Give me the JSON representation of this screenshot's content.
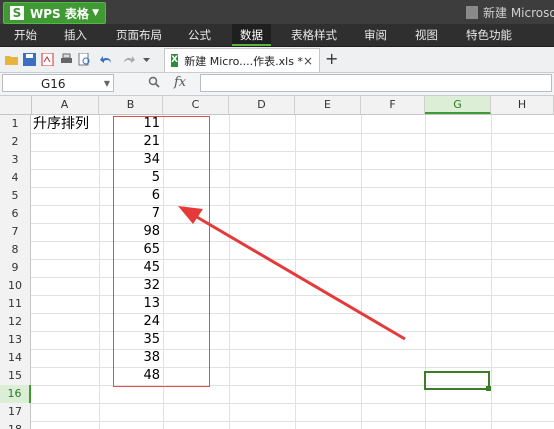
{
  "title_bar": {
    "app_name": "WPS 表格",
    "document_title": "新建 Microso"
  },
  "menu": {
    "items": [
      "开始",
      "插入",
      "页面布局",
      "公式",
      "数据",
      "表格样式",
      "审阅",
      "视图",
      "特色功能"
    ],
    "active": "数据"
  },
  "toolbar": {
    "tab_label": "新建 Micro....作表.xls *",
    "tab_close": "×",
    "tab_add": "+"
  },
  "formula_bar": {
    "name_box": "G16",
    "fx_label": "fx",
    "formula_value": ""
  },
  "sheet": {
    "columns": [
      "A",
      "B",
      "C",
      "D",
      "E",
      "F",
      "G",
      "H"
    ],
    "selected_column": "G",
    "rows": [
      "1",
      "2",
      "3",
      "4",
      "5",
      "6",
      "7",
      "8",
      "9",
      "10",
      "11",
      "12",
      "13",
      "14",
      "15",
      "16",
      "17",
      "18"
    ],
    "selected_row": "16",
    "cell_a1": "升序排列",
    "column_b_values": [
      "11",
      "21",
      "34",
      "5",
      "6",
      "7",
      "98",
      "65",
      "45",
      "32",
      "13",
      "24",
      "35",
      "38",
      "48"
    ]
  },
  "annotation": {
    "box_color": "#e05050",
    "arrow_color": "#e53a3a"
  },
  "colors": {
    "accent": "#3f9a33",
    "title_bar": "#3d3d3d",
    "menu_bar": "#2f2f2f"
  }
}
